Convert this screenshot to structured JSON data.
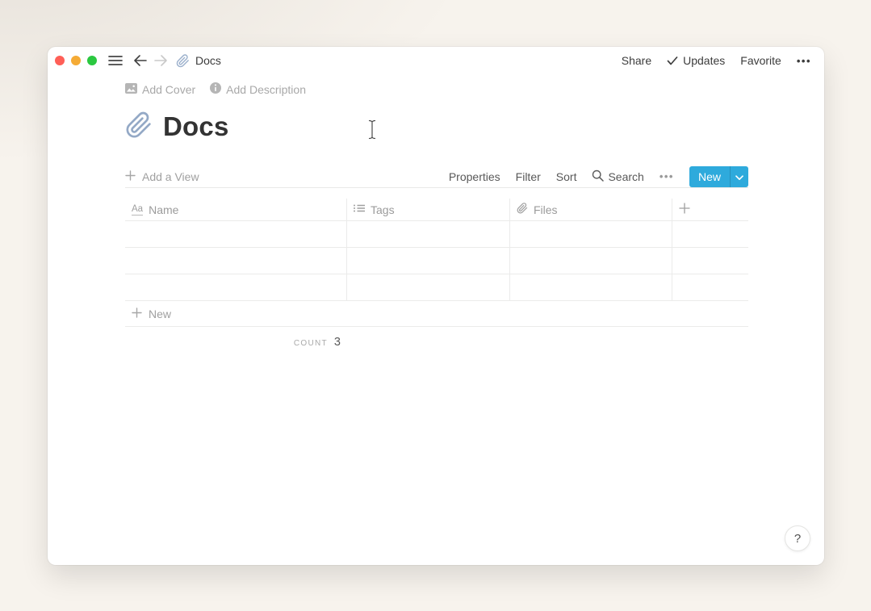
{
  "colors": {
    "accent_blue": "#2eaadc",
    "traffic_red": "#ff5f57",
    "traffic_yellow": "#f5ab36",
    "traffic_green": "#2bc840",
    "background_cream": "#f7f3ed",
    "table_border": "#ebebea",
    "muted_text": "#a0a0a0"
  },
  "titlebar": {
    "breadcrumb": "Docs",
    "share": "Share",
    "updates": "Updates",
    "favorite": "Favorite",
    "more": "•••"
  },
  "page": {
    "add_cover": "Add Cover",
    "add_description": "Add Description",
    "title": "Docs",
    "icon": "paperclip-icon"
  },
  "view_bar": {
    "add_view": "Add a View",
    "properties": "Properties",
    "filter": "Filter",
    "sort": "Sort",
    "search": "Search",
    "more": "•••",
    "new_button": "New"
  },
  "table": {
    "columns": [
      {
        "label": "Name",
        "icon": "text-property-icon"
      },
      {
        "label": "Tags",
        "icon": "multiselect-property-icon"
      },
      {
        "label": "Files",
        "icon": "attachment-property-icon"
      },
      {
        "label": "+",
        "icon": "add-property-icon"
      }
    ],
    "rows": [
      [
        "",
        "",
        "",
        ""
      ],
      [
        "",
        "",
        "",
        ""
      ],
      [
        "",
        "",
        "",
        ""
      ]
    ],
    "new_row_label": "New",
    "footer": {
      "count_label": "COUNT",
      "count_value": "3"
    }
  },
  "help_button": "?"
}
